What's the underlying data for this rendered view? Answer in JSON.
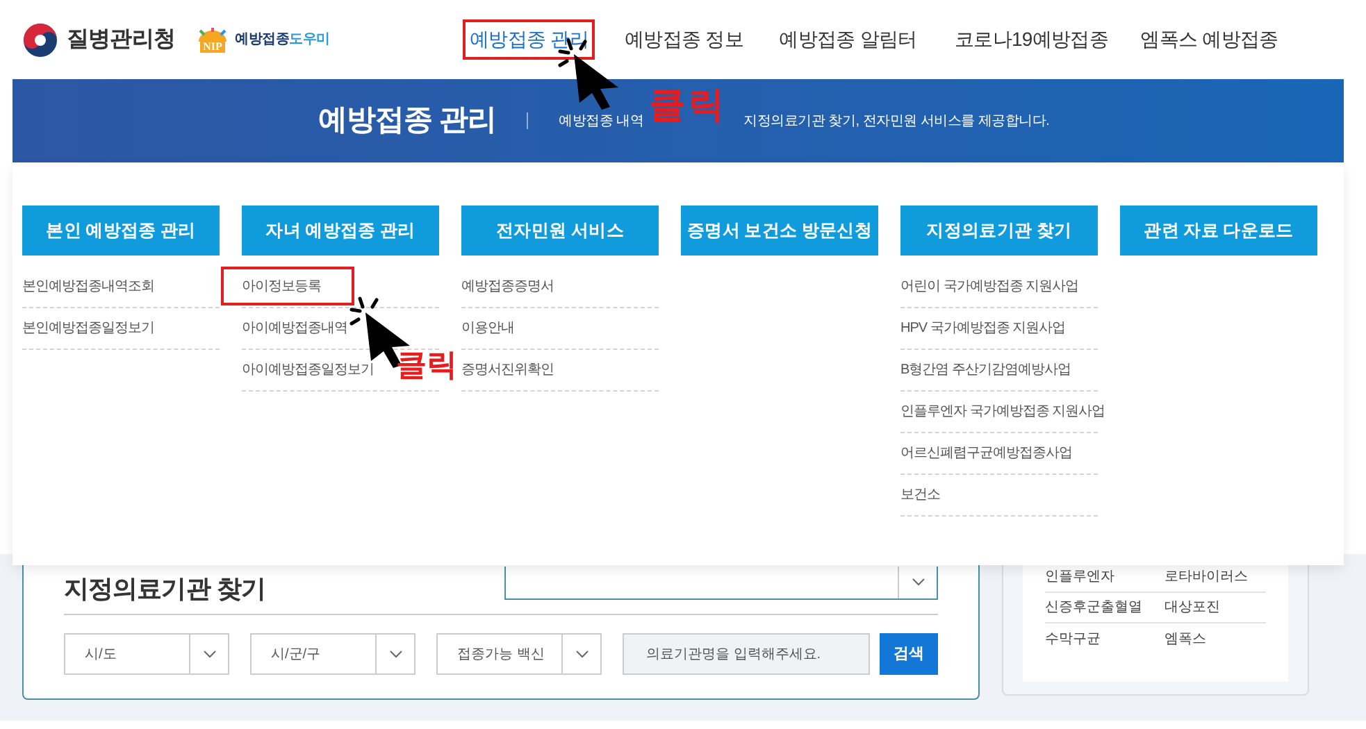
{
  "header": {
    "agency": "질병관리청",
    "logo_letters": "NIP",
    "logo_text": "예방접종",
    "logo_text_accent": "도우미"
  },
  "nav": [
    {
      "label": "예방접종 관리",
      "selected": true,
      "annotated": true
    },
    {
      "label": "예방접종 정보",
      "selected": false,
      "annotated": false
    },
    {
      "label": "예방접종 알림터",
      "selected": false,
      "annotated": false
    },
    {
      "label": "코로나19예방접종",
      "selected": false,
      "annotated": false
    },
    {
      "label": "엠폭스 예방접종",
      "selected": false,
      "annotated": false
    }
  ],
  "banner": {
    "title": "예방접종 관리",
    "subtitle_parts": [
      "예방접종 내역",
      "지정의료기관 찾기, 전자민원 서비스를 제공합니다."
    ]
  },
  "menu": [
    {
      "title": "본인 예방접종 관리",
      "items": [
        {
          "label": "본인예방접종내역조회",
          "annotated": false
        },
        {
          "label": "본인예방접종일정보기",
          "annotated": false
        }
      ]
    },
    {
      "title": "자녀 예방접종 관리",
      "items": [
        {
          "label": "아이정보등록",
          "annotated": true
        },
        {
          "label": "아이예방접종내역",
          "annotated": false
        },
        {
          "label": "아이예방접종일정보기",
          "annotated": false
        }
      ]
    },
    {
      "title": "전자민원 서비스",
      "items": [
        {
          "label": "예방접종증명서",
          "annotated": false
        },
        {
          "label": "이용안내",
          "annotated": false
        },
        {
          "label": "증명서진위확인",
          "annotated": false
        }
      ]
    },
    {
      "title": "증명서 보건소 방문신청"
    },
    {
      "title": "지정의료기관 찾기",
      "items": [
        {
          "label": "어린이 국가예방접종 지원사업",
          "annotated": false
        },
        {
          "label": "HPV 국가예방접종 지원사업",
          "annotated": false
        },
        {
          "label": "B형간염 주산기감염예방사업",
          "annotated": false
        },
        {
          "label": "인플루엔자 국가예방접종 지원사업",
          "annotated": false
        },
        {
          "label": "어르신폐렴구균예방접종사업",
          "annotated": false
        },
        {
          "label": "보건소",
          "annotated": false
        }
      ]
    },
    {
      "title": "관련 자료 다운로드"
    }
  ],
  "annotations": [
    {
      "text": "클릭"
    },
    {
      "text": "클릭"
    }
  ],
  "search": {
    "title": "지정의료기관 찾기",
    "selects": [
      {
        "placeholder": "시/도"
      },
      {
        "placeholder": "시/군/구"
      },
      {
        "placeholder": "접종가능 백신"
      }
    ],
    "input": {
      "placeholder": "의료기관명을 입력해주세요."
    },
    "button": "검색"
  },
  "side_table": {
    "rows": [
      [
        "인플루엔자",
        "로타바이러스"
      ],
      [
        "신증후군출혈열",
        "대상포진"
      ],
      [
        "수막구균",
        "엠폭스"
      ]
    ]
  }
}
